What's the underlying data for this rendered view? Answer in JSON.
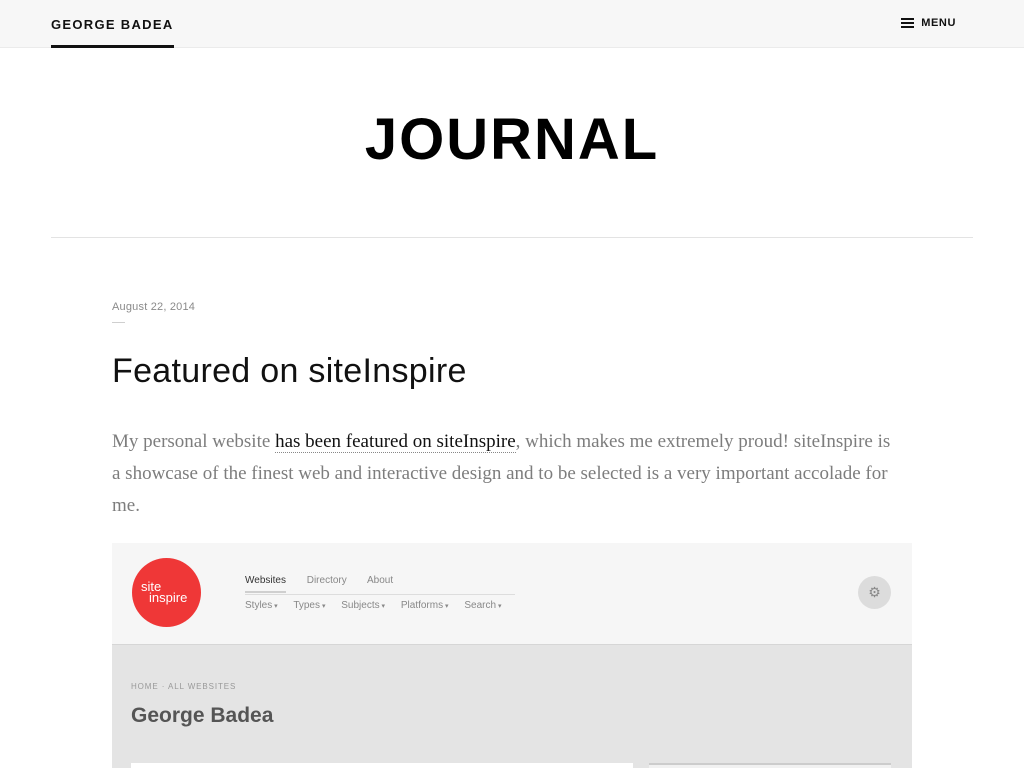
{
  "header": {
    "site_name": "GEORGE BADEA",
    "menu_label": "MENU",
    "menu_icon": "hamburger-icon"
  },
  "page": {
    "title": "JOURNAL"
  },
  "post": {
    "date": "August 22, 2014",
    "title": "Featured on siteInspire",
    "body_before_link": "My personal website ",
    "link_text": "has been featured on siteInspire",
    "body_after_link": ", which makes me extremely proud! siteInspire is a showcase of the finest web and interactive design and to be selected is a very important accolade for me."
  },
  "screenshot": {
    "logo_line1": "site",
    "logo_line2": "inspire",
    "nav": [
      "Websites",
      "Directory",
      "About"
    ],
    "subnav": [
      "Styles",
      "Types",
      "Subjects",
      "Platforms",
      "Search"
    ],
    "settings_icon": "gear-icon",
    "breadcrumb": "HOME · ALL WEBSITES",
    "name": "George Badea"
  },
  "colors": {
    "accent": "#111111",
    "logo_red": "#ef3737",
    "muted_text": "#7d7d7d"
  }
}
